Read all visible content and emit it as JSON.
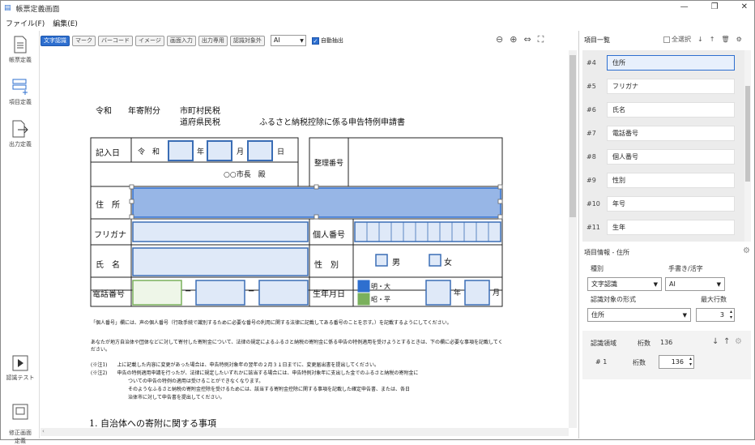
{
  "window": {
    "title": "帳票定義画面",
    "min": "—",
    "max": "❐",
    "close": "✕"
  },
  "menu": [
    "ファイル(F)",
    "編集(E)"
  ],
  "leftbar": [
    {
      "label": "帳票定義"
    },
    {
      "label": "項目定義"
    },
    {
      "label": "出力定義"
    },
    {
      "label": "認識テスト"
    },
    {
      "label": "修正画面\n定義"
    }
  ],
  "toolbar": {
    "buttons": [
      "文字認識",
      "マーク",
      "バーコード",
      "イメージ",
      "画面入力",
      "出力専用",
      "認識対象外"
    ],
    "engine": "AI",
    "auto_extract": "自動抽出"
  },
  "doc": {
    "line1a": "令和",
    "line1b": "年寄附分",
    "line1c": "市町村民税",
    "line2a": "道府県民税",
    "line2b": "ふるさと納税控除に係る申告特例申請書",
    "kinyubi": "記入日",
    "reiwa": "令　和",
    "nen": "年",
    "gatsu": "月",
    "nichi": "日",
    "seiribangou": "整理番号",
    "chocho": "○○市長　殿",
    "jusho": "住　所",
    "furigana": "フリガナ",
    "kojinbango": "個人番号",
    "shimei": "氏　名",
    "seibetsu": "性　別",
    "otoko": "男",
    "onna": "女",
    "denwa": "電話番号",
    "seinengappi": "生年月日",
    "era1": "明・大",
    "era2": "昭・平",
    "note1": "「個人番号」欄には、声の個人番号（行政手続で識別するために必要な番号の利用に関する法律に記載してある番号のことを示す。）を記載するようにしてください。",
    "note2": "あなたが地方自治体や団体などに対して寄付した寄附金について、法律の規定によるふるさと納税の寄附金に係る申告の特例適用を受けようとするときは、下の欄に必要な事項を記載してください。",
    "note3": "(※注1)　　上に記載した内容に変更があった場合は、申告特例対象年の翌年の２月３１日までに、変更届出書を提出してください。",
    "note4": "(※注2)　　申告の特例適用申請を行ったが、法律に規定したいずれかに該当する場合には、申告特例対象年に支出した金でのふるさと納税の寄附金に",
    "note5": "ついての申告の特例の適用は受けることができなくなります。",
    "note6": "そのようなふるさと納税の寄附金控除を受けるためには、該当する寄附金控除に関する事項を記載した確定申告書、または、各日",
    "note7": "治体市に対して申告書を提出してください。",
    "section": "1. 自治体への寄附に関する事項"
  },
  "itemlist": {
    "title": "項目一覧",
    "select_all": "全選択",
    "items": [
      {
        "num": "#4",
        "name": "住所"
      },
      {
        "num": "#5",
        "name": "フリガナ"
      },
      {
        "num": "#6",
        "name": "氏名"
      },
      {
        "num": "#7",
        "name": "電話番号"
      },
      {
        "num": "#8",
        "name": "個人番号"
      },
      {
        "num": "#9",
        "name": "性別"
      },
      {
        "num": "#10",
        "name": "年号"
      },
      {
        "num": "#11",
        "name": "生年"
      }
    ]
  },
  "props": {
    "title": "項目情報 - 住所",
    "type_label": "種別",
    "type_value": "文字認識",
    "hand_label": "手書き/活字",
    "hand_value": "AI",
    "format_label": "認識対象の形式",
    "format_value": "住所",
    "maxrows_label": "最大行数",
    "maxrows_value": "3",
    "region_label": "認識領域",
    "digits_label": "桁数",
    "digits_value": "136",
    "row_num": "# 1",
    "row_digits_label": "桁数",
    "row_digits_value": "136"
  }
}
